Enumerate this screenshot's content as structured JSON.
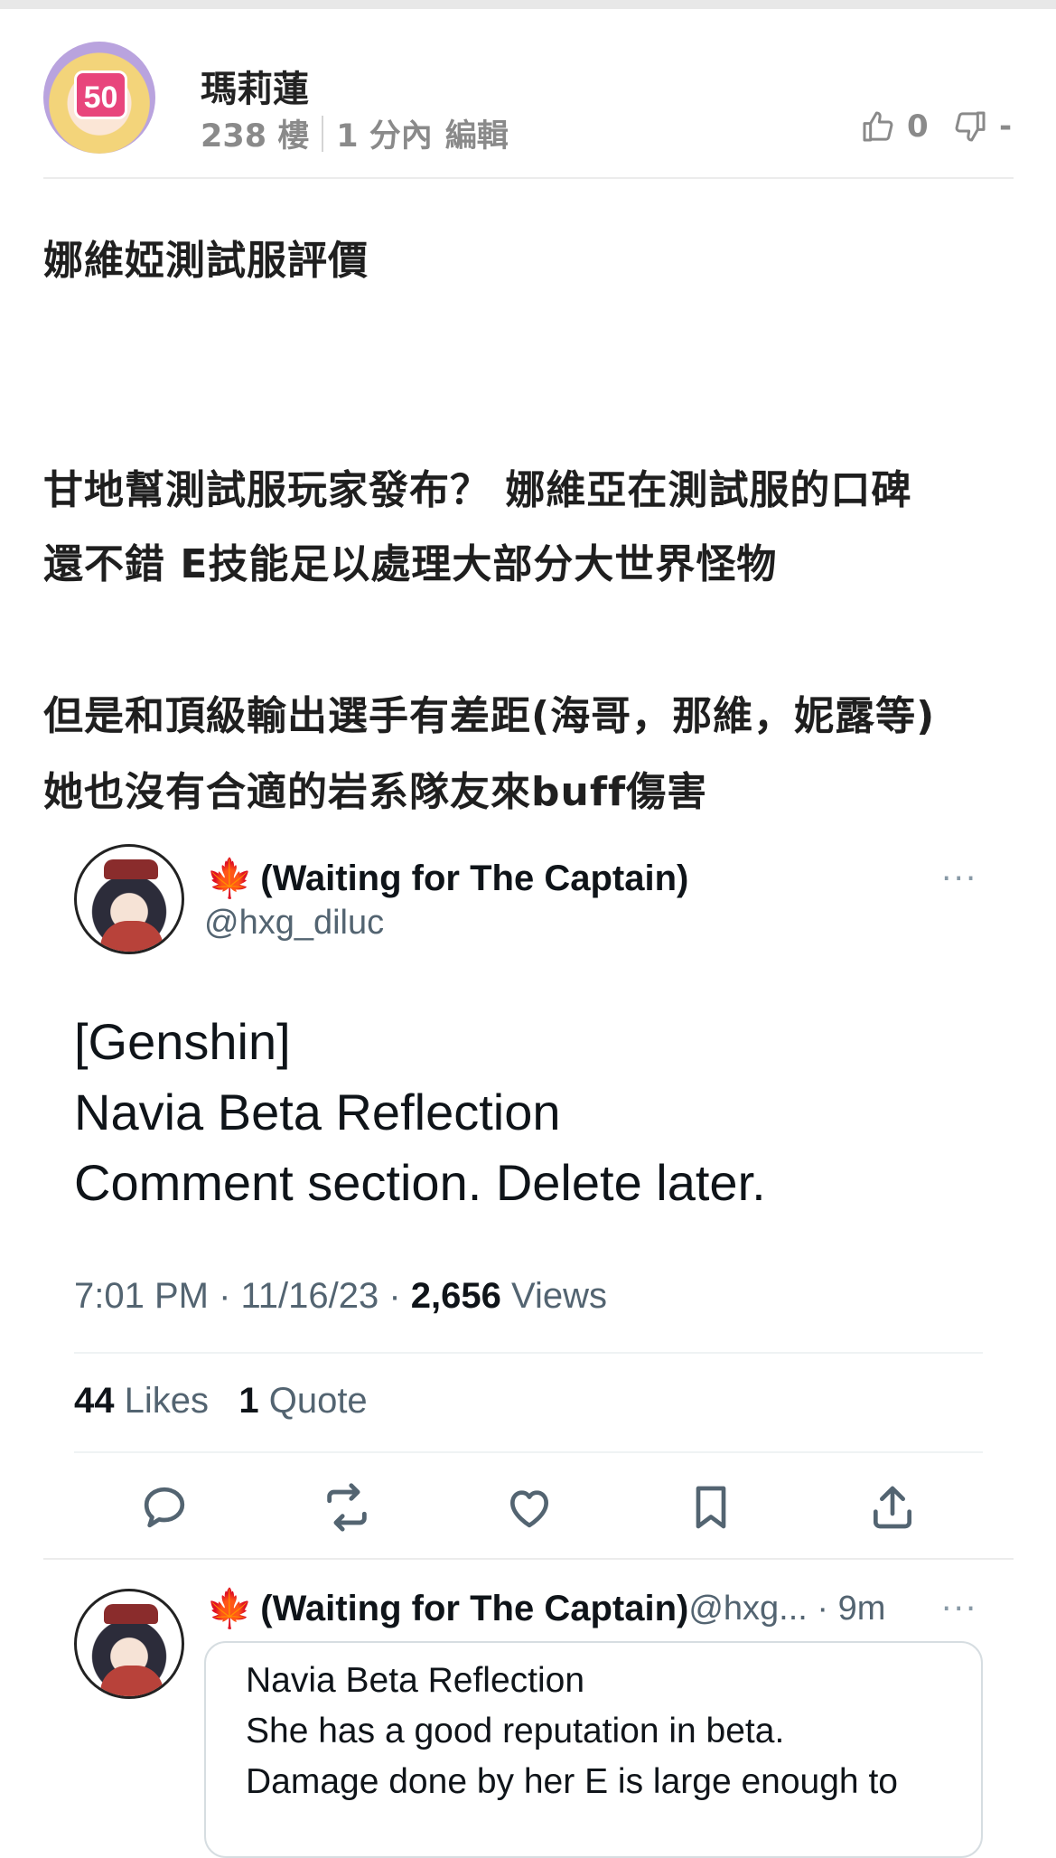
{
  "floor": {
    "username": "瑪莉蓮",
    "level": "50",
    "floor_number": "238 樓",
    "time_ago": "1 分內",
    "edit_label": "編輯",
    "like_count": "0",
    "dislike_count": "-"
  },
  "post": {
    "title": "娜維婭測試服評價",
    "lines": [
      "甘地幫測試服玩家發布？ 娜維亞在測試服的口碑",
      "還不錯 E技能足以處理大部分大世界怪物",
      "但是和頂級輸出選手有差距(海哥，那維，妮露等)",
      "她也沒有合適的岩系隊友來buff傷害"
    ]
  },
  "tweet": {
    "display_name": "(Waiting for The Captain)",
    "handle": "@hxg_diluc",
    "text_lines": [
      "[Genshin]",
      "Navia Beta Reflection",
      "Comment section. Delete later."
    ],
    "time": "7:01 PM · 11/16/23 · ",
    "views_count": "2,656",
    "views_label": " Views",
    "likes_count": "44",
    "likes_label": " Likes",
    "quote_count": "1",
    "quote_label": " Quote",
    "more": "···"
  },
  "reply": {
    "display_name": "(Waiting for The Captain)",
    "handle_time": " @hxg... · 9m",
    "more": "···",
    "lines": [
      "Navia Beta Reflection",
      "She has a good reputation in beta.",
      "Damage done by her E is large enough to"
    ]
  },
  "colors": {
    "level_badge": "#e8457c",
    "twitter_text": "#0f1419",
    "twitter_muted": "#536471"
  },
  "icons": [
    "thumbs-up-icon",
    "thumbs-down-icon",
    "reply-icon",
    "retweet-icon",
    "heart-icon",
    "bookmark-icon",
    "share-icon",
    "maple-leaf-icon"
  ]
}
